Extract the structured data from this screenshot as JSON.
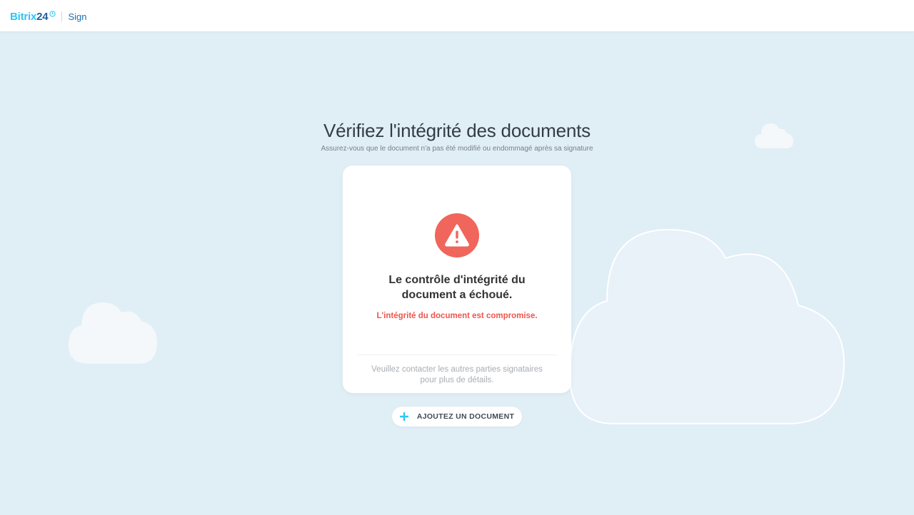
{
  "header": {
    "logo_bitrix": "Bitrix",
    "logo_24": "24",
    "product": "Sign"
  },
  "main": {
    "title": "Vérifiez l'intégrité des documents",
    "subtitle": "Assurez-vous que le document n'a pas été modifié ou endommagé après sa signature"
  },
  "result_card": {
    "icon": "warning-icon",
    "heading_line1": "Le contrôle d'intégrité du",
    "heading_line2": "document a échoué.",
    "error_text": "L'intégrité du document est compromise.",
    "footer_line1": "Veuillez contacter les autres parties signataires",
    "footer_line2": "pour plus de détails."
  },
  "add_button": {
    "icon": "plus-icon",
    "label": "AJOUTEZ UN DOCUMENT"
  },
  "colors": {
    "background": "#e0eef6",
    "accent_blue": "#2fc6f6",
    "logo_dark_blue": "#215f98",
    "error_red": "#f0554f",
    "card_bg": "#ffffff"
  }
}
